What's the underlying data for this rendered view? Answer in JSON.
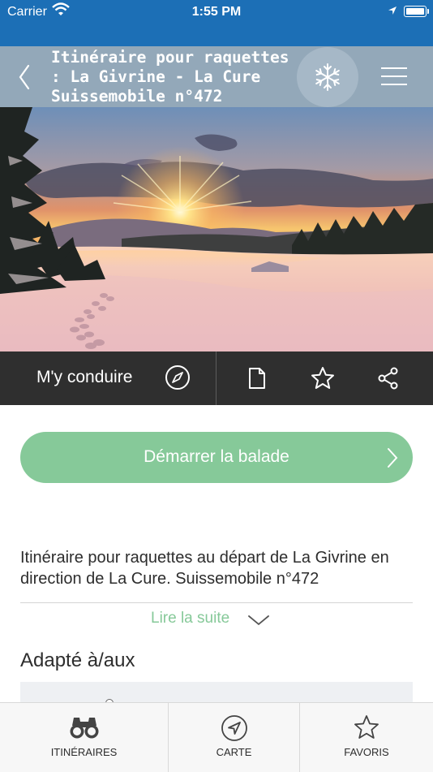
{
  "status_bar": {
    "carrier": "Carrier",
    "time": "1:55 PM"
  },
  "header": {
    "title": "Itinéraire pour raquettes : La Givrine - La Cure Suissemobile n°472",
    "snow_icon": "snowflake-icon",
    "menu_icon": "hamburger-menu-icon",
    "back_icon": "chevron-left-icon"
  },
  "hero": {
    "image": "winter sunset over snowy field with snowshoe tracks"
  },
  "actions": {
    "drive_label": "M'y conduire",
    "icons": [
      "compass-icon",
      "document-icon",
      "star-icon",
      "share-icon"
    ]
  },
  "start_button": {
    "label": "Démarrer la balade"
  },
  "description": {
    "text": "Itinéraire pour raquettes au départ de La Givrine en direction de La Cure. Suissemobile n°472",
    "read_more": "Lire la suite"
  },
  "section": {
    "title": "Adapté à/aux"
  },
  "tabs": [
    {
      "label": "ITINÉRAIRES",
      "icon": "binoculars-icon"
    },
    {
      "label": "CARTE",
      "icon": "navigation-icon"
    },
    {
      "label": "FAVORIS",
      "icon": "star-icon"
    }
  ],
  "colors": {
    "status_bar": "#1c6fb6",
    "header": "#93a8b9",
    "action_bar": "#2f2f2f",
    "accent_green": "#86c999"
  }
}
